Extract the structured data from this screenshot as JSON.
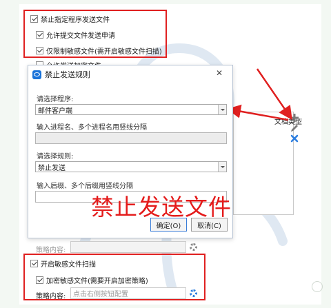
{
  "top_section": {
    "block_transfer_label": "禁止指定程序发送文件",
    "allow_apply_label": "允许提交文件发送申请",
    "restrict_sensitive_label": "仅限制敏感文件(需开启敏感文件扫描)",
    "allow_encrypted_label": "允许发送加密文件"
  },
  "right_column": {
    "file_type_header": "文档类型"
  },
  "dialog": {
    "title": "禁止发送规则",
    "close_glyph": "✕",
    "program_label": "请选择程序:",
    "program_value": "邮件客户端",
    "process_label": "输入进程名、多个进程名用竖线分隔",
    "process_value": "",
    "rule_label": "请选择规则:",
    "rule_value": "禁止发送",
    "suffix_label": "输入后缀、多个后缀用竖线分隔",
    "suffix_value": "",
    "ok_label": "确定(O)",
    "cancel_label": "取消(C)"
  },
  "caption": "禁止发送文件",
  "policy_row": {
    "label": "策略内容:",
    "value": ""
  },
  "bottom_section": {
    "sensitive_scan_label": "开启敏感文件扫描",
    "encrypt_sensitive_label": "加密敏感文件(需要开启加密策略)",
    "policy_label": "策略内容:",
    "policy_placeholder": "点击右侧按钮配置"
  },
  "colors": {
    "highlight_red": "#e02020",
    "accent_blue": "#1a73d9"
  }
}
